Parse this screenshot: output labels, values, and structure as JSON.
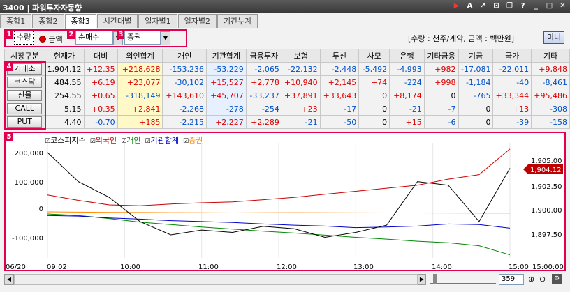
{
  "window": {
    "title": "3400 | 파워투자자동향"
  },
  "tabs": [
    {
      "label": "종합1"
    },
    {
      "label": "종합2"
    },
    {
      "label": "종합3"
    },
    {
      "label": "시간대별"
    },
    {
      "label": "일자별1"
    },
    {
      "label": "일자별2"
    },
    {
      "label": "기간누계"
    }
  ],
  "controls": {
    "marker1": "1",
    "marker2": "2",
    "marker3": "3",
    "marker4": "4",
    "marker5": "5",
    "quantity_label": "수량",
    "amount_label": "금액",
    "select1_value": "순매수",
    "select2_value": "증권",
    "unit_note": "[수량 : 천주/계약, 금액 : 백만원]",
    "mini_button": "미니"
  },
  "table": {
    "headers": [
      "시장구분",
      "현재가",
      "대비",
      "외인합계",
      "개인",
      "기관합계",
      "금융투자",
      "보험",
      "투신",
      "사모",
      "은행",
      "기타금융",
      "기금",
      "국가",
      "기타"
    ],
    "rows": [
      {
        "market": "거래소",
        "cells": [
          "1,904.12",
          "+12.35",
          "+218,628",
          "-153,236",
          "-53,229",
          "-2,065",
          "-22,132",
          "-2,448",
          "-5,492",
          "-4,993",
          "+982",
          "-17,081",
          "-22,011",
          "+9,848"
        ]
      },
      {
        "market": "코스닥",
        "cells": [
          "484.55",
          "+6.19",
          "+23,077",
          "-30,102",
          "+15,527",
          "+2,778",
          "+10,940",
          "+2,145",
          "+74",
          "-224",
          "+998",
          "-1,184",
          "-40",
          "-8,461"
        ]
      },
      {
        "market": "선물",
        "cells": [
          "254.55",
          "+0.65",
          "-318,149",
          "+143,610",
          "+45,707",
          "-33,237",
          "+37,891",
          "+33,643",
          "0",
          "+8,174",
          "0",
          "-765",
          "+33,344",
          "+95,486"
        ]
      },
      {
        "market": "CALL",
        "cells": [
          "5.15",
          "+0.35",
          "+2,841",
          "-2,268",
          "-278",
          "-254",
          "+23",
          "-17",
          "0",
          "-21",
          "-7",
          "0",
          "+13",
          "-308"
        ]
      },
      {
        "market": "PUT",
        "cells": [
          "4.40",
          "-0.70",
          "+185",
          "-2,215",
          "+2,227",
          "+2,289",
          "-21",
          "-50",
          "0",
          "+15",
          "-6",
          "0",
          "-39",
          "-158"
        ]
      }
    ]
  },
  "chart_data": {
    "type": "line",
    "legend": [
      "코스피지수",
      "외국인",
      "개인",
      "기관합계",
      "증권"
    ],
    "colors": {
      "kospi": "#000000",
      "foreign": "#cc0000",
      "individual": "#008800",
      "inst": "#0000cc",
      "sec": "#ff8800"
    },
    "left_ticks": [
      "200,000",
      "100,000",
      "0",
      "-100,000"
    ],
    "right_ticks": [
      "1,905.00",
      "1,902.50",
      "1,900.00",
      "1,897.50"
    ],
    "current_price_label": "1,904.12",
    "x_ticks": [
      "06/20",
      "09:02",
      "10:00",
      "11:00",
      "12:00",
      "13:00",
      "14:00",
      "15:00",
      "15:00:00"
    ],
    "ylim_left": [
      -150000,
      230000
    ],
    "ylim_right": [
      1896.5,
      1906.0
    ],
    "series": [
      {
        "key": "foreign",
        "values": [
          58000,
          40000,
          25000,
          22000,
          28000,
          32000,
          35000,
          42000,
          50000,
          60000,
          70000,
          80000,
          90000,
          110000,
          125000,
          210000
        ]
      },
      {
        "key": "individual",
        "values": [
          -5000,
          -10000,
          -20000,
          -32000,
          -40000,
          -48000,
          -55000,
          -62000,
          -68000,
          -75000,
          -82000,
          -88000,
          -95000,
          -100000,
          -110000,
          -140000
        ]
      },
      {
        "key": "inst",
        "values": [
          -10000,
          -12000,
          -18000,
          -22000,
          -27000,
          -30000,
          -33000,
          -38000,
          -42000,
          -45000,
          -50000,
          -48000,
          -45000,
          -38000,
          -40000,
          -52000
        ]
      },
      {
        "key": "sec",
        "values": [
          2000,
          1000,
          500,
          0,
          -500,
          -1000,
          -1500,
          -1000,
          -500,
          -800,
          -1200,
          -1500,
          -1500,
          -1800,
          -2000,
          -2065
        ]
      }
    ],
    "kospi": [
      1905.2,
      1902.8,
      1901.5,
      1899.5,
      1898.4,
      1898.8,
      1898.6,
      1899.1,
      1898.9,
      1898.2,
      1898.6,
      1899.2,
      1902.8,
      1902.5,
      1899.5,
      1903.9
    ]
  },
  "bottom": {
    "count_value": "359"
  }
}
